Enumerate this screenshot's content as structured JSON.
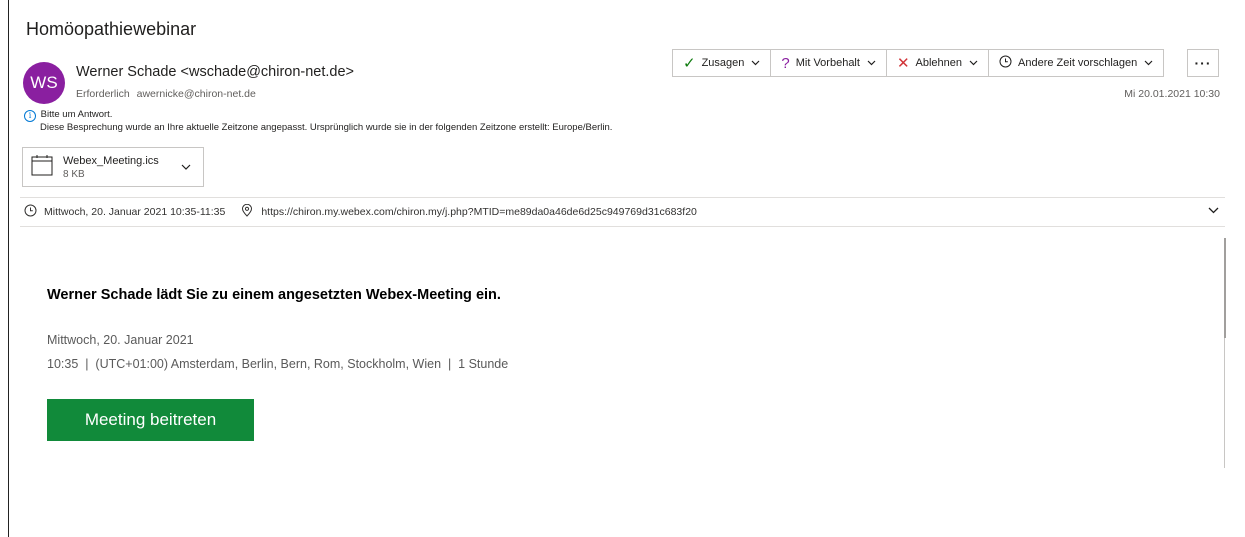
{
  "subject": "Homöopathiewebinar",
  "sender": {
    "initials": "WS",
    "display": "Werner Schade <wschade@chiron-net.de>",
    "required_label": "Erforderlich",
    "required_address": "awernicke@chiron-net.de"
  },
  "received_date": "Mi 20.01.2021 10:30",
  "actions": {
    "accept": "Zusagen",
    "tentative": "Mit Vorbehalt",
    "decline": "Ablehnen",
    "propose": "Andere Zeit vorschlagen",
    "more": "···"
  },
  "info": {
    "icon": "i",
    "reply_request": "Bitte um Antwort.",
    "timezone_note": "Diese Besprechung wurde an Ihre aktuelle Zeitzone angepasst. Ursprünglich wurde sie in der folgenden Zeitzone erstellt: Europe/Berlin."
  },
  "attachment": {
    "name": "Webex_Meeting.ics",
    "size": "8 KB"
  },
  "meeting": {
    "time": "Mittwoch, 20. Januar 2021 10:35-11:35",
    "location": "https://chiron.my.webex.com/chiron.my/j.php?MTID=me89da0a46de6d25c949769d31c683f20"
  },
  "invite": {
    "title": "Werner Schade lädt Sie zu einem angesetzten Webex-Meeting ein.",
    "date": "Mittwoch, 20. Januar 2021",
    "time_line": "10:35  |  (UTC+01:00) Amsterdam, Berlin, Bern, Rom, Stockholm, Wien  |  1 Stunde",
    "join_label": "Meeting beitreten"
  },
  "icons": {
    "check": "✓",
    "question": "?",
    "cross": "✕",
    "chevron": "⌄"
  },
  "colors": {
    "avatar": "#8a1fa0",
    "accept_green": "#107c10",
    "tentative_purple": "#8a1fa0",
    "decline_red": "#d13438",
    "join_button": "#118a3a"
  }
}
